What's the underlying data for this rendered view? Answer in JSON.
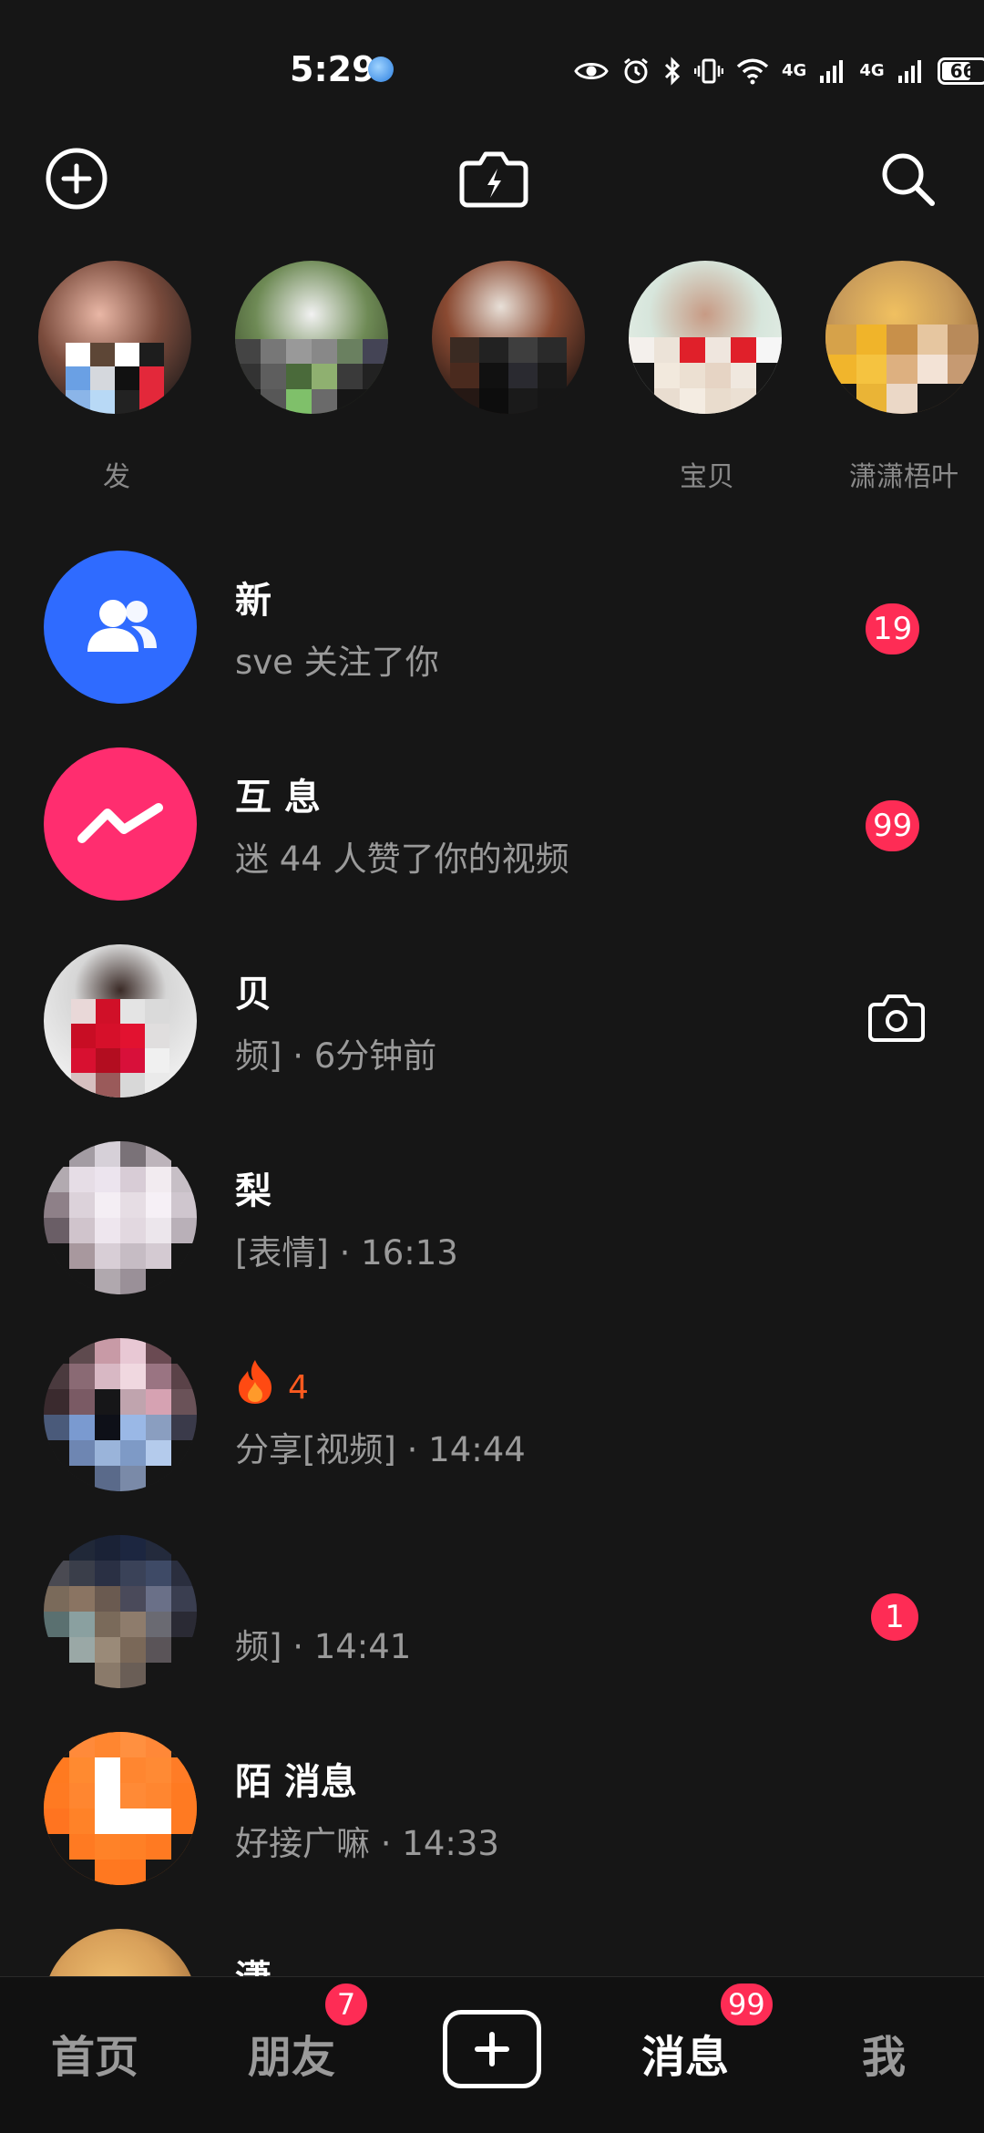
{
  "status_bar": {
    "time": "5:29",
    "net1": "4G",
    "net2": "4G",
    "battery": "66"
  },
  "top_bar": {
    "add_icon": "plus-circle-icon",
    "flash_icon": "camera-flash-icon",
    "search_icon": "search-icon"
  },
  "stories": [
    {
      "name": "发"
    },
    {
      "name": ""
    },
    {
      "name": ""
    },
    {
      "name": "宝贝"
    },
    {
      "name": "潇潇梧叶"
    }
  ],
  "conversations": [
    {
      "title": "新",
      "subtitle": "sve  关注了你",
      "badge": "19"
    },
    {
      "title": "互  息",
      "subtitle": "迷  44 人赞了你的视频",
      "badge": "99"
    },
    {
      "title": "  贝",
      "subtitle": "  频] · 6分钟前",
      "action_icon": "camera-icon"
    },
    {
      "title": "  梨",
      "subtitle": "  [表情] · 16:13"
    },
    {
      "title": "  ",
      "streak": "4",
      "subtitle": "  分享[视频] · 14:44"
    },
    {
      "title": "",
      "subtitle": "  频] · 14:41",
      "badge": "1"
    },
    {
      "title": "陌  消息",
      "subtitle": "  好接广嘛 · 14:33"
    },
    {
      "title": "潇",
      "subtitle": ""
    }
  ],
  "bottom_nav": {
    "home": "首页",
    "friends": "朋友",
    "friends_badge": "7",
    "messages": "消息",
    "messages_badge": "99",
    "me": "我"
  },
  "colors": {
    "background": "#161616",
    "badge": "#fe2c55",
    "new_followers": "#2f6bff",
    "interactions": "#ff2d6f",
    "streak": "#ff5a1f"
  }
}
